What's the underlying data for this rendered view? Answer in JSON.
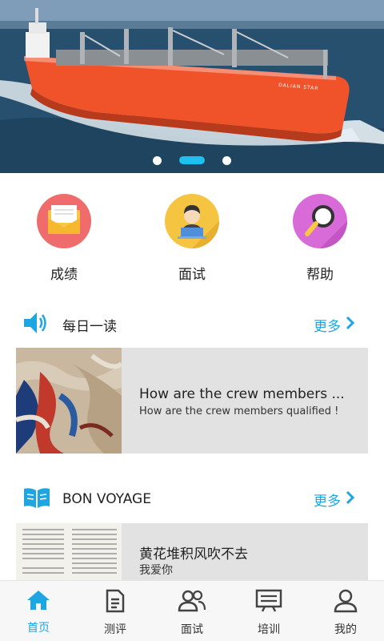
{
  "banner": {
    "ship_name": "DALIAN STAR",
    "active_index": 1,
    "indicator_count": 3
  },
  "quick_menu": [
    {
      "label": "成绩",
      "icon": "envelope-icon",
      "color": "#f06b6b"
    },
    {
      "label": "面试",
      "icon": "person-laptop-icon",
      "color": "#f5c542"
    },
    {
      "label": "帮助",
      "icon": "magnifier-icon",
      "color": "#d96bd9"
    }
  ],
  "daily_read": {
    "title": "每日一读",
    "more": "更多",
    "item": {
      "title": "How are the crew members ...",
      "subtitle": "How are the crew members qualified !"
    }
  },
  "bon_voyage": {
    "title": "BON VOYAGE",
    "more": "更多",
    "item": {
      "title": "黄花堆积风吹不去",
      "subtitle": "我爱你"
    }
  },
  "tabbar": [
    {
      "label": "首页",
      "icon": "home-icon",
      "active": true
    },
    {
      "label": "测评",
      "icon": "document-icon",
      "active": false
    },
    {
      "label": "面试",
      "icon": "people-icon",
      "active": false
    },
    {
      "label": "培训",
      "icon": "board-icon",
      "active": false
    },
    {
      "label": "我的",
      "icon": "user-icon",
      "active": false
    }
  ],
  "colors": {
    "accent": "#1ea6e3",
    "indicator": "#1ec0f0",
    "hull": "#f0522a",
    "card_bg": "#e2e2e2"
  }
}
